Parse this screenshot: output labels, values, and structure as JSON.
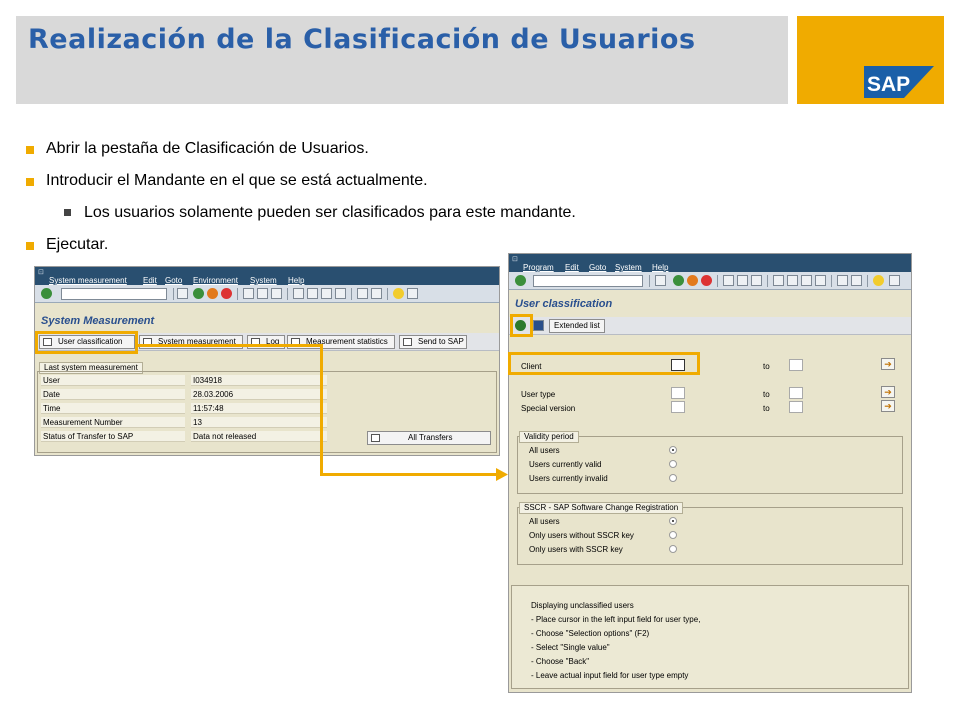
{
  "slide": {
    "title": "Realización de la Clasificación de Usuarios",
    "logo_text": "SAP",
    "bullets": [
      "Abrir la pestaña de Clasificación de Usuarios.",
      "Introducir el Mandante en el que se está actualmente.",
      "Los usuarios solamente pueden ser clasificados para este mandante.",
      "Ejecutar."
    ],
    "colors": {
      "gold": "#f0ab00",
      "title_blue": "#2a5fa8",
      "sap_menubar": "#294f70"
    }
  },
  "left_window": {
    "menu": [
      "System measurement",
      "Edit",
      "Goto",
      "Environment",
      "System",
      "Help"
    ],
    "title": "System Measurement",
    "app_buttons": [
      "User classification",
      "System measurement",
      "Log",
      "Measurement statistics",
      "Send to SAP"
    ],
    "group_label": "Last system measurement",
    "rows": [
      {
        "key": "User",
        "value": "I034918"
      },
      {
        "key": "Date",
        "value": "28.03.2006"
      },
      {
        "key": "Time",
        "value": "11:57:48"
      },
      {
        "key": "Measurement Number",
        "value": "13"
      },
      {
        "key": "Status of Transfer to SAP",
        "value": "Data not released"
      }
    ],
    "all_transfers_label": "All Transfers"
  },
  "right_window": {
    "menu": [
      "Program",
      "Edit",
      "Goto",
      "System",
      "Help"
    ],
    "title": "User classification",
    "extended_list_label": "Extended list",
    "client_label": "Client",
    "client_value": "",
    "to_label": "to",
    "user_type_label": "User type",
    "special_version_label": "Special version",
    "validity": {
      "title": "Validity period",
      "options": [
        "All users",
        "Users currently valid",
        "Users currently invalid"
      ],
      "selected": 0
    },
    "sscr": {
      "title": "SSCR - SAP Software Change Registration",
      "options": [
        "All users",
        "Only users without SSCR key",
        "Only users with SSCR key"
      ],
      "selected": 0
    },
    "info_lines": [
      "Displaying unclassified users",
      "- Place cursor in the left input field for user type,",
      "- Choose \"Selection options\" (F2)",
      "- Select \"Single value\"",
      "- Choose \"Back\"",
      "- Leave actual input field for user type empty"
    ]
  }
}
